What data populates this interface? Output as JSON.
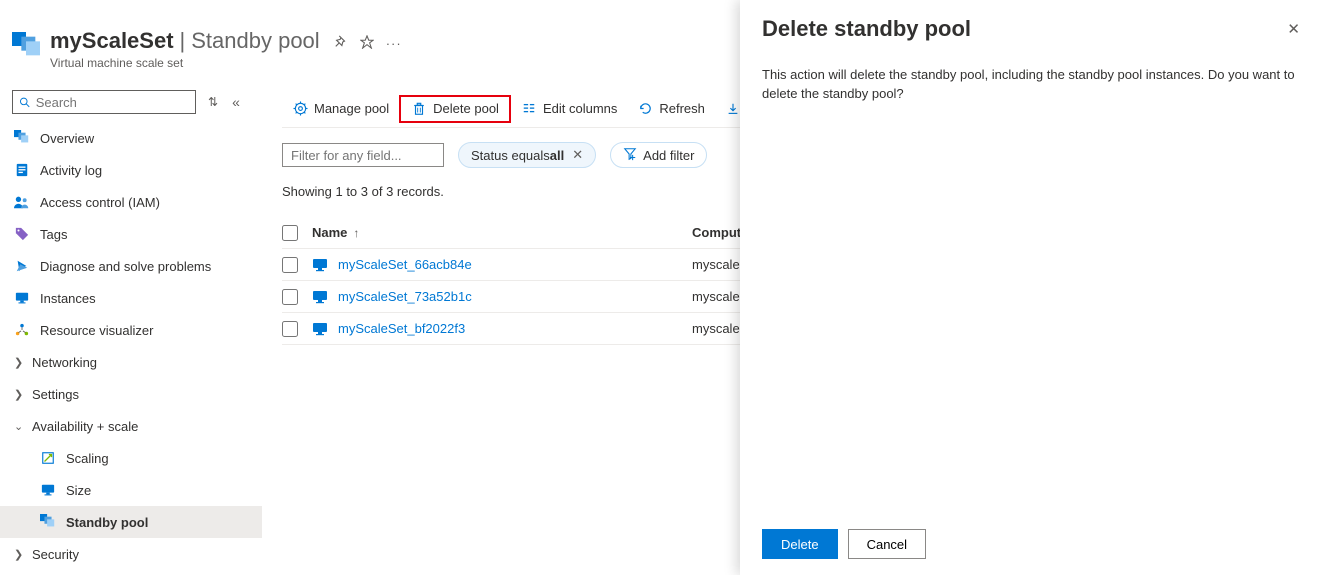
{
  "header": {
    "title_main": "myScaleSet",
    "title_sub": "Standby pool",
    "subtitle": "Virtual machine scale set"
  },
  "sidebar": {
    "search_placeholder": "Search",
    "items": [
      {
        "label": "Overview"
      },
      {
        "label": "Activity log"
      },
      {
        "label": "Access control (IAM)"
      },
      {
        "label": "Tags"
      },
      {
        "label": "Diagnose and solve problems"
      },
      {
        "label": "Instances"
      },
      {
        "label": "Resource visualizer"
      },
      {
        "label": "Networking"
      },
      {
        "label": "Settings"
      },
      {
        "label": "Availability + scale"
      },
      {
        "label": "Scaling"
      },
      {
        "label": "Size"
      },
      {
        "label": "Standby pool"
      },
      {
        "label": "Security"
      }
    ]
  },
  "toolbar": {
    "manage_pool": "Manage pool",
    "delete_pool": "Delete pool",
    "edit_columns": "Edit columns",
    "refresh": "Refresh",
    "export": "Ex"
  },
  "filters": {
    "filter_placeholder": "Filter for any field...",
    "status_prefix": "Status equals ",
    "status_value": "all",
    "add_filter": "Add filter"
  },
  "showing_text": "Showing 1 to 3 of 3 records.",
  "table": {
    "head_name": "Name",
    "head_comp": "Compute",
    "rows": [
      {
        "name": "myScaleSet_66acb84e",
        "comp": "myscalese"
      },
      {
        "name": "myScaleSet_73a52b1c",
        "comp": "myscalese"
      },
      {
        "name": "myScaleSet_bf2022f3",
        "comp": "myscalese"
      }
    ]
  },
  "panel": {
    "title": "Delete standby pool",
    "body": "This action will delete the standby pool, including the standby pool instances. Do you want to delete the standby pool?",
    "delete_btn": "Delete",
    "cancel_btn": "Cancel"
  }
}
